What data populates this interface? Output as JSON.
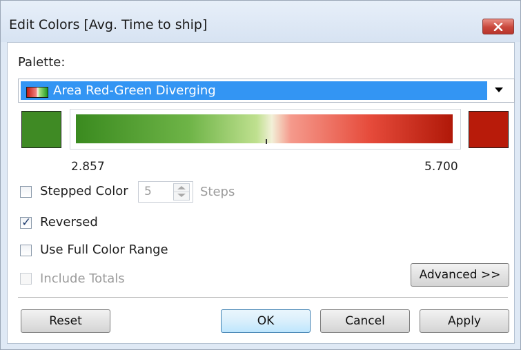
{
  "window": {
    "title": "Edit Colors [Avg. Time to ship]",
    "close_icon": "close-icon"
  },
  "palette": {
    "label": "Palette:",
    "selected": "Area Red-Green Diverging",
    "swatch_icon": "palette-swatch-icon"
  },
  "range": {
    "start_color": "#3f8a24",
    "end_color": "#b81b0a",
    "min_label": "2.857",
    "max_label": "5.700"
  },
  "options": {
    "stepped_color": {
      "label": "Stepped Color",
      "checked": false
    },
    "steps": {
      "value": "5",
      "unit_label": "Steps"
    },
    "reversed": {
      "label": "Reversed",
      "checked": true
    },
    "use_full_range": {
      "label": "Use Full Color Range",
      "checked": false
    },
    "include_totals": {
      "label": "Include Totals",
      "checked": false,
      "disabled": true
    }
  },
  "buttons": {
    "advanced": "Advanced >>",
    "reset": "Reset",
    "ok": "OK",
    "cancel": "Cancel",
    "apply": "Apply"
  }
}
